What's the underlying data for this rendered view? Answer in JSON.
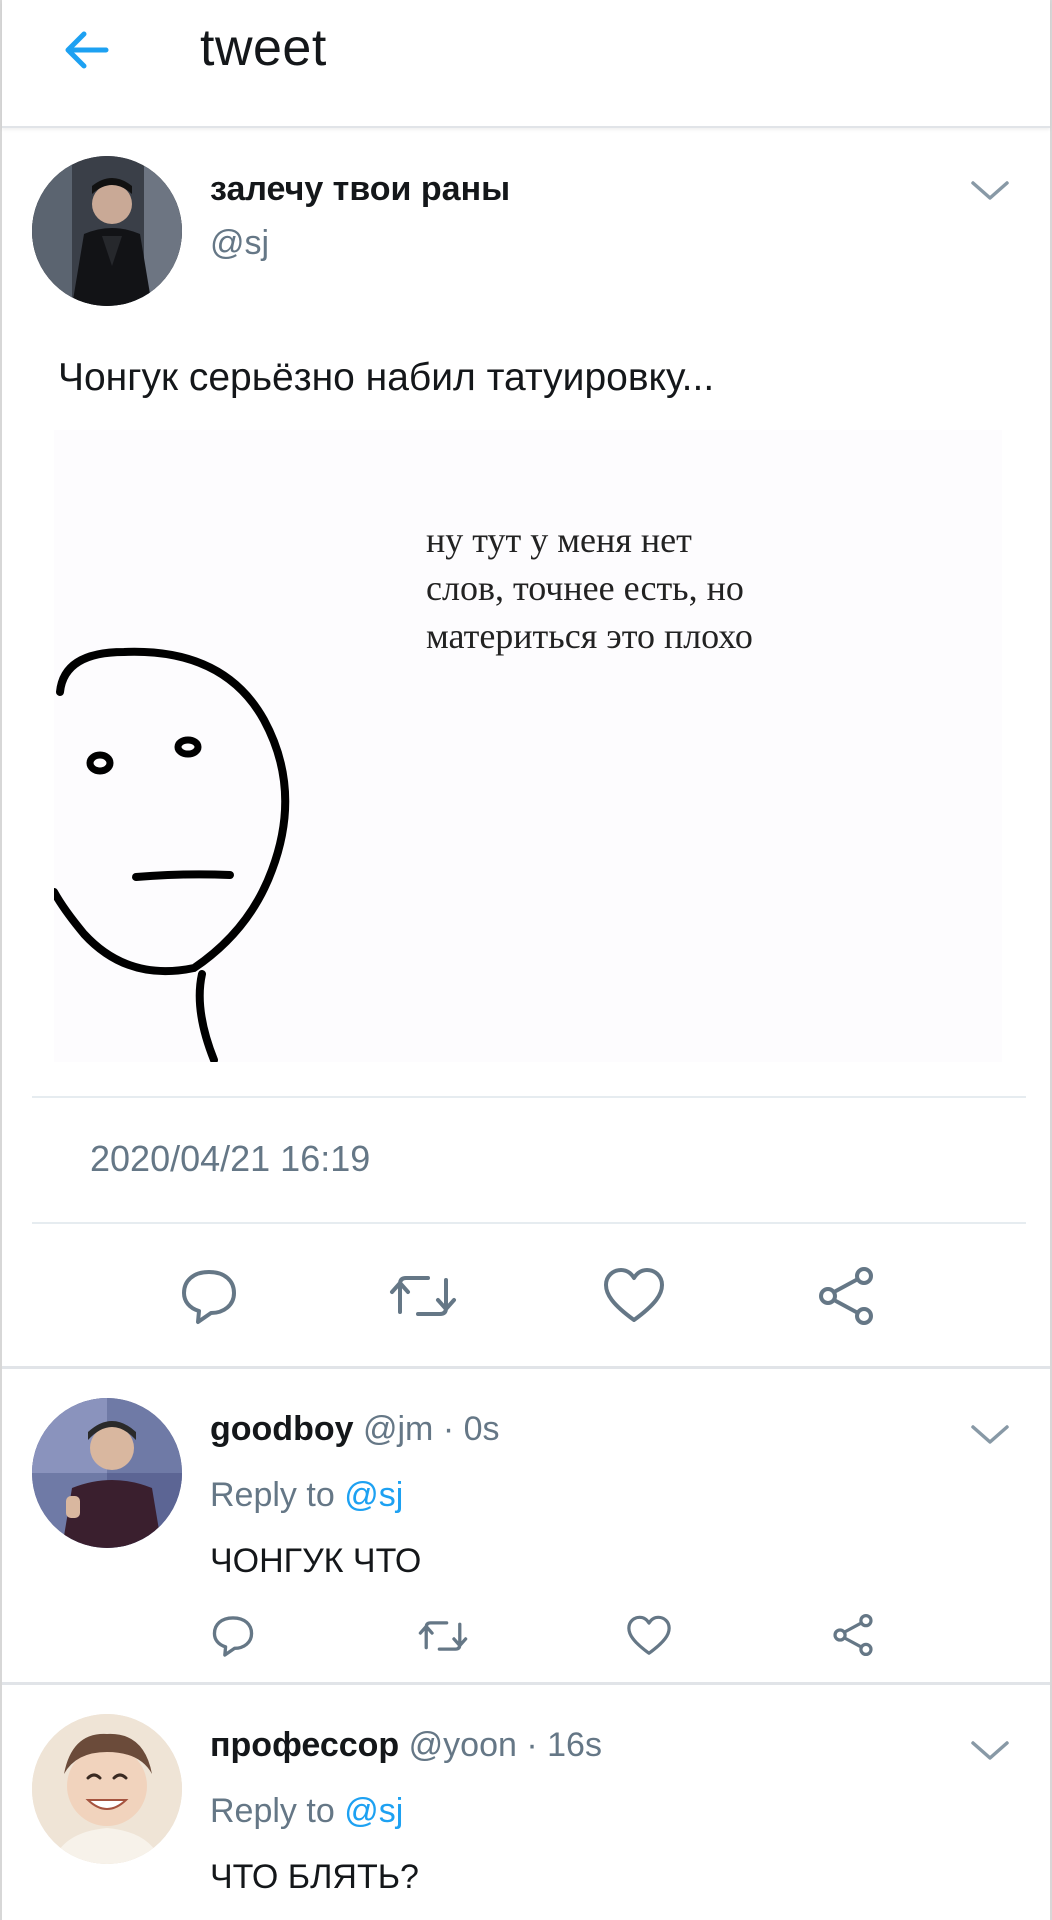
{
  "header": {
    "title": "tweet",
    "back_icon": "arrow-left-icon",
    "accent": "#1da1f2"
  },
  "tweet": {
    "author_name": "залечу твои раны",
    "author_handle": "@sj",
    "text": "Чонгук серьёзно набил татуировку...",
    "media_caption": "ну тут у меня нет\nслов, точнее есть, но\nматериться это плохо",
    "timestamp": "2020/04/21 16:19",
    "actions": [
      "reply-icon",
      "retweet-icon",
      "like-icon",
      "share-icon"
    ]
  },
  "replies": [
    {
      "name": "goodboy",
      "handle": "@jm",
      "dot": "·",
      "time": "0s",
      "reply_to_label": "Reply to",
      "reply_to_handle": "@sj",
      "text": "ЧОНГУК ЧТО"
    },
    {
      "name": "профессор",
      "handle": "@yoon",
      "dot": "·",
      "time": "16s",
      "reply_to_label": "Reply to",
      "reply_to_handle": "@sj",
      "text": "ЧТО БЛЯТЬ?"
    }
  ],
  "colors": {
    "text": "#14171a",
    "secondary": "#657786",
    "link": "#1da1f2",
    "icon": "#657786"
  }
}
